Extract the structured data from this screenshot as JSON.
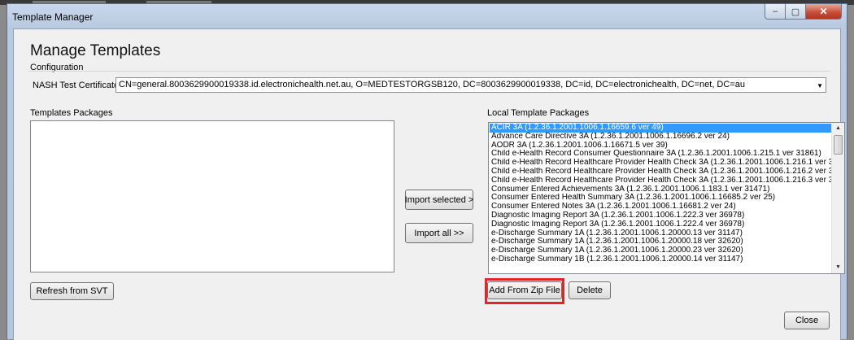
{
  "window": {
    "title": "Template Manager",
    "controls": {
      "minimize": "–",
      "maximize": "▢",
      "close": "✕"
    }
  },
  "page": {
    "heading": "Manage Templates",
    "config_group_label": "Configuration",
    "certificate_label": "NASH Test Certificate",
    "certificate_value": "CN=general.8003629900019338.id.electronichealth.net.au, O=MEDTESTORGSB120, DC=8003629900019338, DC=id, DC=electronichealth, DC=net, DC=au"
  },
  "left_panel": {
    "label": "Templates Packages",
    "items": []
  },
  "right_panel": {
    "label": "Local Template Packages",
    "items": [
      {
        "label": "ACIR 3A  (1.2.36.1.2001.1006.1.16659.6 ver 49)",
        "selected": true
      },
      {
        "label": "Advance Care Directive 3A  (1.2.36.1.2001.1006.1.16696.2 ver 24)"
      },
      {
        "label": "AODR 3A  (1.2.36.1.2001.1006.1.16671.5 ver 39)"
      },
      {
        "label": "Child e-Health Record Consumer Questionnaire 3A  (1.2.36.1.2001.1006.1.215.1 ver 31861)"
      },
      {
        "label": "Child e-Health Record Healthcare Provider Health Check 3A  (1.2.36.1.2001.1006.1.216.1 ver 31869"
      },
      {
        "label": "Child e-Health Record Healthcare Provider Health Check 3A  (1.2.36.1.2001.1006.1.216.2 ver 3272"
      },
      {
        "label": "Child e-Health Record Healthcare Provider Health Check 3A  (1.2.36.1.2001.1006.1.216.3 ver 3272"
      },
      {
        "label": "Consumer Entered Achievements 3A  (1.2.36.1.2001.1006.1.183.1 ver 31471)"
      },
      {
        "label": "Consumer Entered Health Summary 3A  (1.2.36.1.2001.1006.1.16685.2 ver 25)"
      },
      {
        "label": "Consumer Entered Notes 3A  (1.2.36.1.2001.1006.1.16681.2 ver 24)"
      },
      {
        "label": "Diagnostic Imaging Report 3A  (1.2.36.1.2001.1006.1.222.3 ver 36978)"
      },
      {
        "label": "Diagnostic Imaging Report 3A  (1.2.36.1.2001.1006.1.222.4 ver 36978)"
      },
      {
        "label": "e-Discharge Summary 1A  (1.2.36.1.2001.1006.1.20000.13 ver 31147)"
      },
      {
        "label": "e-Discharge Summary 1A  (1.2.36.1.2001.1006.1.20000.18 ver 32620)"
      },
      {
        "label": "e-Discharge Summary 1A  (1.2.36.1.2001.1006.1.20000.23 ver 32620)"
      },
      {
        "label": "e-Discharge Summary 1B  (1.2.36.1.2001.1006.1.20000.14 ver 31147)"
      }
    ]
  },
  "buttons": {
    "import_selected": "Import selected >",
    "import_all": "Import all >>",
    "refresh": "Refresh from SVT",
    "add_zip": "Add From Zip File",
    "delete": "Delete",
    "close": "Close"
  },
  "icons": {
    "dropdown": "▼",
    "scroll_up": "▲",
    "scroll_down": "▼"
  },
  "colors": {
    "selection": "#3399ff",
    "highlight": "#e02626",
    "title_bar": "#c9d7ea"
  }
}
